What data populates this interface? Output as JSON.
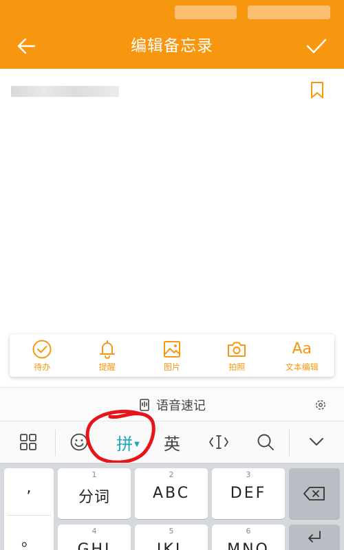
{
  "appbar": {
    "title": "编辑备忘录",
    "background": "#f7960f",
    "back_icon": "arrow-left-icon",
    "save_icon": "checkmark-icon"
  },
  "editor": {
    "bookmark_icon": "bookmark-icon"
  },
  "toolbar": {
    "items": [
      {
        "label": "待办",
        "icon": "check-circle-icon"
      },
      {
        "label": "提醒",
        "icon": "bell-icon"
      },
      {
        "label": "图片",
        "icon": "image-icon"
      },
      {
        "label": "拍照",
        "icon": "camera-icon"
      },
      {
        "label": "文本编辑",
        "icon": "text-format-icon",
        "glyph": "Aa"
      }
    ],
    "accent": "#f7960f"
  },
  "voice": {
    "label": "语音速记",
    "icon": "voice-note-icon",
    "settings_icon": "gear-icon"
  },
  "ime": {
    "grid_icon": "grid-icon",
    "emoji_icon": "emoji-icon",
    "pinyin_label": "拼",
    "english_label": "英",
    "cursor_icon": "cursor-move-icon",
    "search_icon": "search-icon",
    "collapse_icon": "chevron-down-icon",
    "pinyin_color": "#1aa7b8",
    "annotation_color": "#e8141c"
  },
  "keyboard": {
    "side_symbols": [
      ",",
      "。"
    ],
    "keys": [
      {
        "num": "1",
        "label": "分词"
      },
      {
        "num": "2",
        "label": "ABC"
      },
      {
        "num": "3",
        "label": "DEF"
      },
      {
        "num": "4",
        "label": "GHI"
      },
      {
        "num": "5",
        "label": "JKL"
      },
      {
        "num": "6",
        "label": "MNO"
      }
    ],
    "backspace_icon": "backspace-icon"
  }
}
